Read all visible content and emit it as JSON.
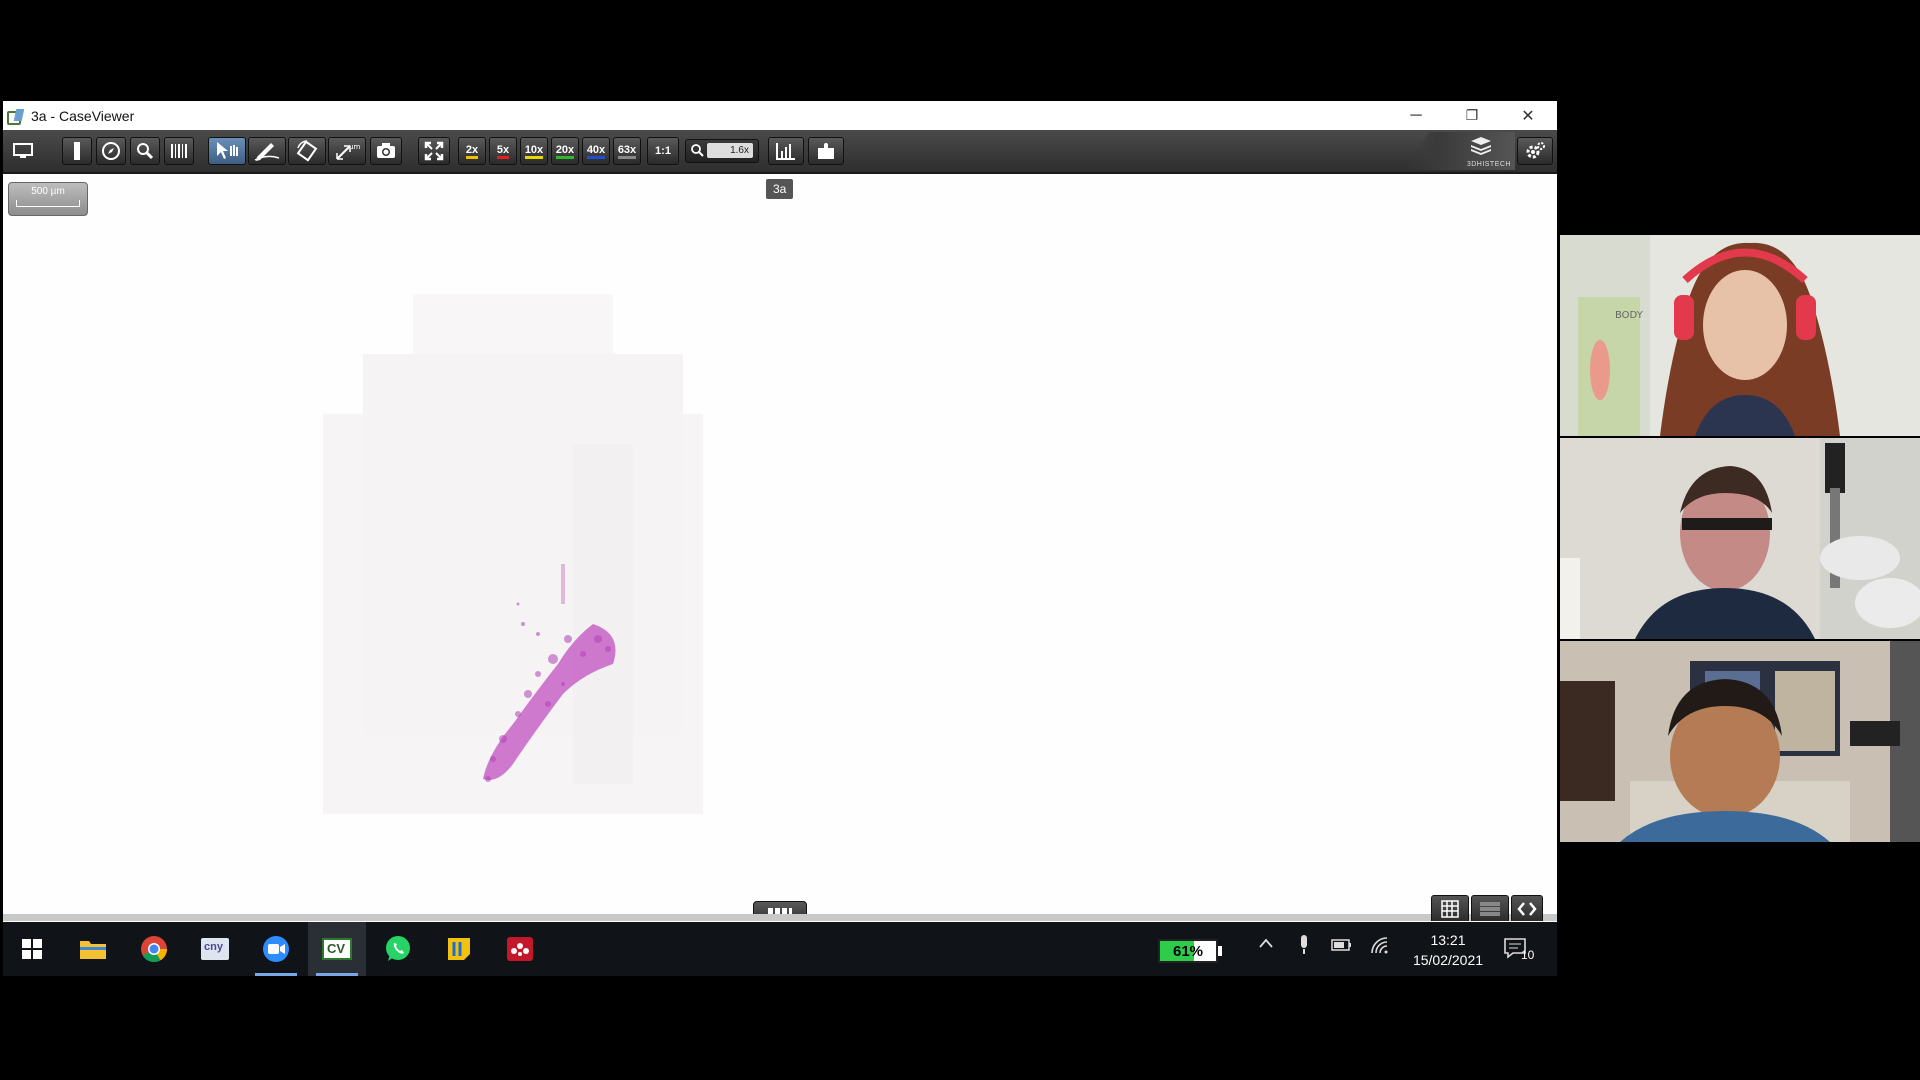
{
  "window": {
    "title": "3a - CaseViewer",
    "controls": {
      "minimize": "─",
      "restore": "❐",
      "close": "✕"
    }
  },
  "toolbar": {
    "magnifications": [
      {
        "label": "2x",
        "color": "#f0c000"
      },
      {
        "label": "5x",
        "color": "#e02020"
      },
      {
        "label": "10x",
        "color": "#e6d800"
      },
      {
        "label": "20x",
        "color": "#2eb82e"
      },
      {
        "label": "40x",
        "color": "#1e4fd0"
      },
      {
        "label": "63x",
        "color": "#888888"
      }
    ],
    "one_to_one": "1:1",
    "zoom_value": "1.6x",
    "brand": "3DHISTECH"
  },
  "viewer": {
    "scalebar_label": "500 µm",
    "slide_label": "3a",
    "stain_color": "#c050c0"
  },
  "taskbar": {
    "apps": [
      {
        "name": "windows-start",
        "open": false
      },
      {
        "name": "file-explorer",
        "open": false
      },
      {
        "name": "chrome",
        "open": false
      },
      {
        "name": "app-cny",
        "label": "cny",
        "open": false
      },
      {
        "name": "zoom",
        "open": true
      },
      {
        "name": "caseviewer",
        "label": "CV",
        "open": true
      },
      {
        "name": "whatsapp",
        "open": false
      },
      {
        "name": "sticky-app",
        "open": false
      },
      {
        "name": "mendeley",
        "open": false
      }
    ],
    "battery_overlay": "61%",
    "battery_level": 0.61,
    "time": "13:21",
    "date": "15/02/2021",
    "notification_count": "10"
  },
  "participants": [
    {
      "id": "participant-1",
      "poster_text": "BODY"
    },
    {
      "id": "participant-2"
    },
    {
      "id": "participant-3"
    }
  ]
}
